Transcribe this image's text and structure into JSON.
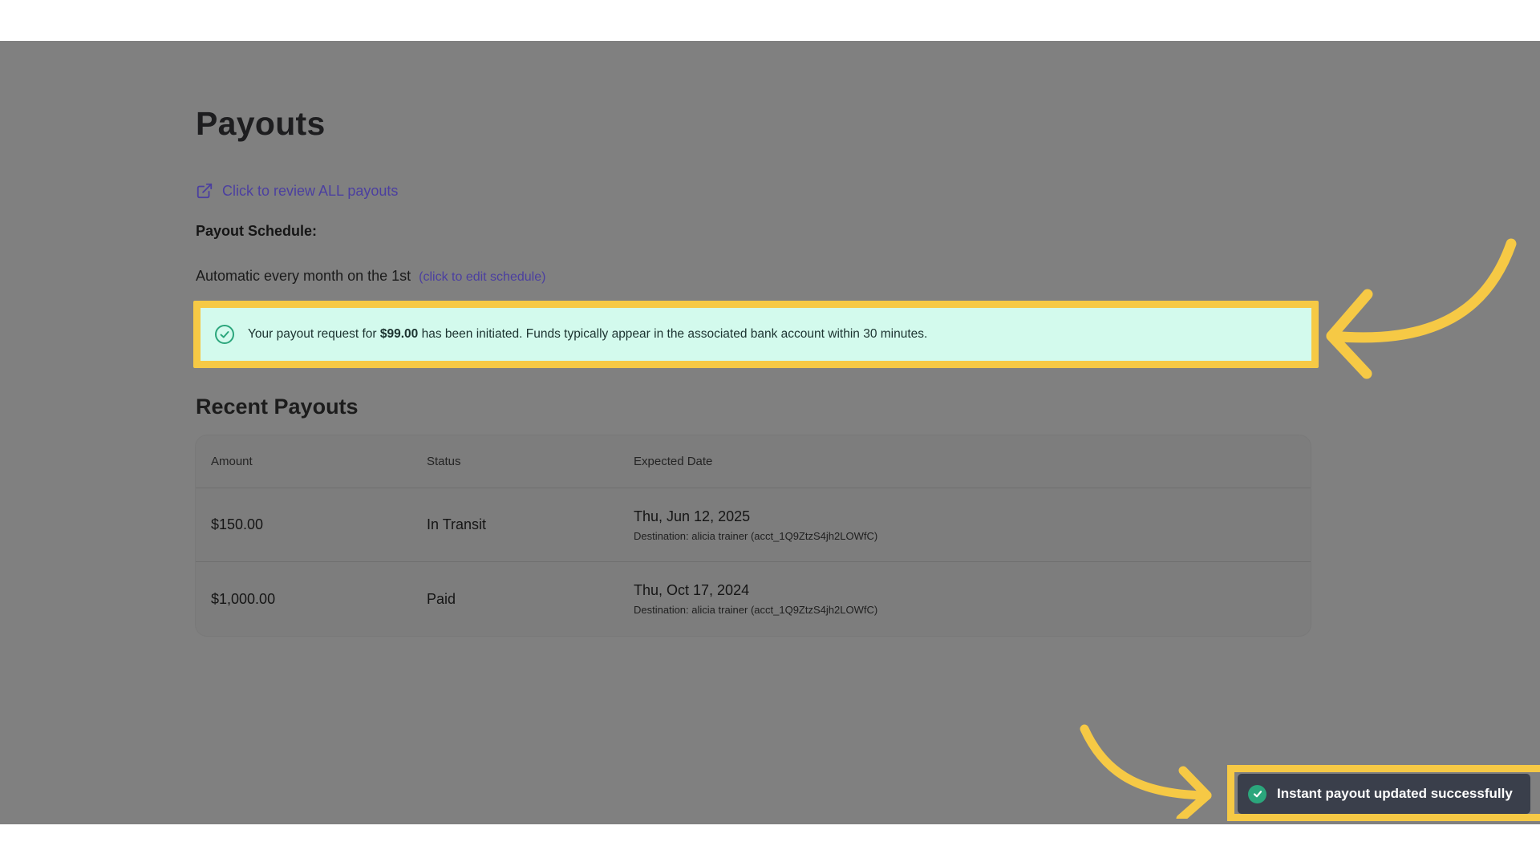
{
  "page": {
    "title": "Payouts",
    "review_link": "Click to review ALL payouts",
    "schedule_heading": "Payout Schedule:",
    "schedule_text": "Automatic every month on the 1st",
    "schedule_edit": "(click to edit schedule)"
  },
  "alert": {
    "prefix": "Your payout request for",
    "amount": "$99.00",
    "suffix": "has been initiated. Funds typically appear in the associated bank account within 30 minutes."
  },
  "recent": {
    "title": "Recent Payouts",
    "columns": [
      "Amount",
      "Status",
      "Expected Date"
    ],
    "rows": [
      {
        "amount": "$150.00",
        "status": "In Transit",
        "date": "Thu, Jun 12, 2025",
        "destination": "Destination: alicia trainer (acct_1Q9ZtzS4jh2LOWfC)"
      },
      {
        "amount": "$1,000.00",
        "status": "Paid",
        "date": "Thu, Oct 17, 2024",
        "destination": "Destination: alicia trainer (acct_1Q9ZtzS4jh2LOWfC)"
      }
    ]
  },
  "toast": {
    "message": "Instant payout updated successfully",
    "icon": "check-circle-icon"
  },
  "colors": {
    "overlay": "#808080",
    "link": "#4b3fa0",
    "alert_bg": "#d3faed",
    "highlight": "#f6c945",
    "toast_bg": "#3a3f4b",
    "success": "#2ba67c"
  }
}
